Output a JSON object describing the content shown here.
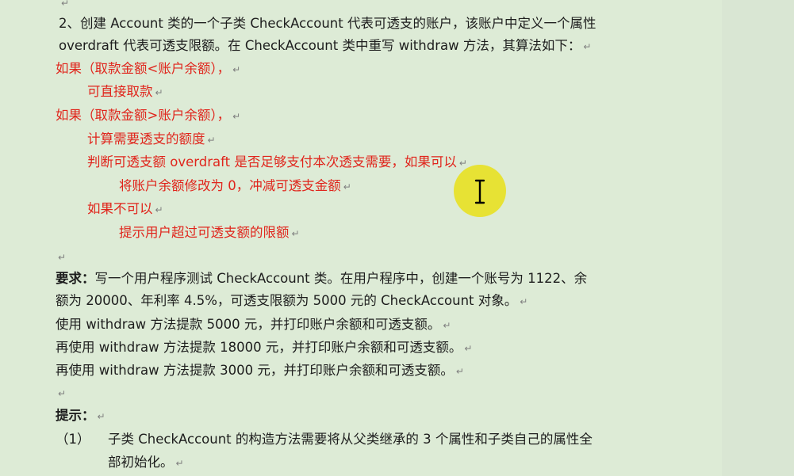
{
  "paragraph_mark": "↵",
  "task": {
    "line1": "2、创建 Account 类的一个子类 CheckAccount 代表可透支的账户，该账户中定义一个属性",
    "line2": "overdraft 代表可透支限额。在 CheckAccount 类中重写 withdraw 方法，其算法如下："
  },
  "algorithm": {
    "if_less": "如果（取款金额<账户余额），",
    "withdraw_directly": "可直接取款",
    "if_greater": "如果（取款金额>账户余额），",
    "calc_overdraft": "计算需要透支的额度",
    "judge": "判断可透支额 overdraft 是否足够支付本次透支需要，如果可以",
    "set_balance": "将账户余额修改为 0，冲减可透支金额",
    "if_not": "如果不可以",
    "prompt_user": "提示用户超过可透支额的限额"
  },
  "requirement": {
    "label": "要求：",
    "text1": "写一个用户程序测试 CheckAccount 类。在用户程序中，创建一个账号为 1122、余",
    "text2": "额为 20000、年利率 4.5%，可透支限额为 5000 元的 CheckAccount 对象。",
    "step1": "使用 withdraw 方法提款 5000 元，并打印账户余额和可透支额。",
    "step2": "再使用 withdraw 方法提款 18000 元，并打印账户余额和可透支额。",
    "step3": "再使用 withdraw 方法提款 3000 元，并打印账户余额和可透支额。"
  },
  "hint": {
    "label": "提示：",
    "item1_number": "（1）",
    "item1_line1": "子类 CheckAccount 的构造方法需要将从父类继承的 3 个属性和子类自己的属性全",
    "item1_line2": "部初始化。"
  },
  "colors": {
    "background": "#ddebd6",
    "body_text": "#1d1d1d",
    "algorithm_text": "#e0251c",
    "cursor_highlight": "#e8e01e",
    "paragraph_mark": "#7f7f7f"
  }
}
